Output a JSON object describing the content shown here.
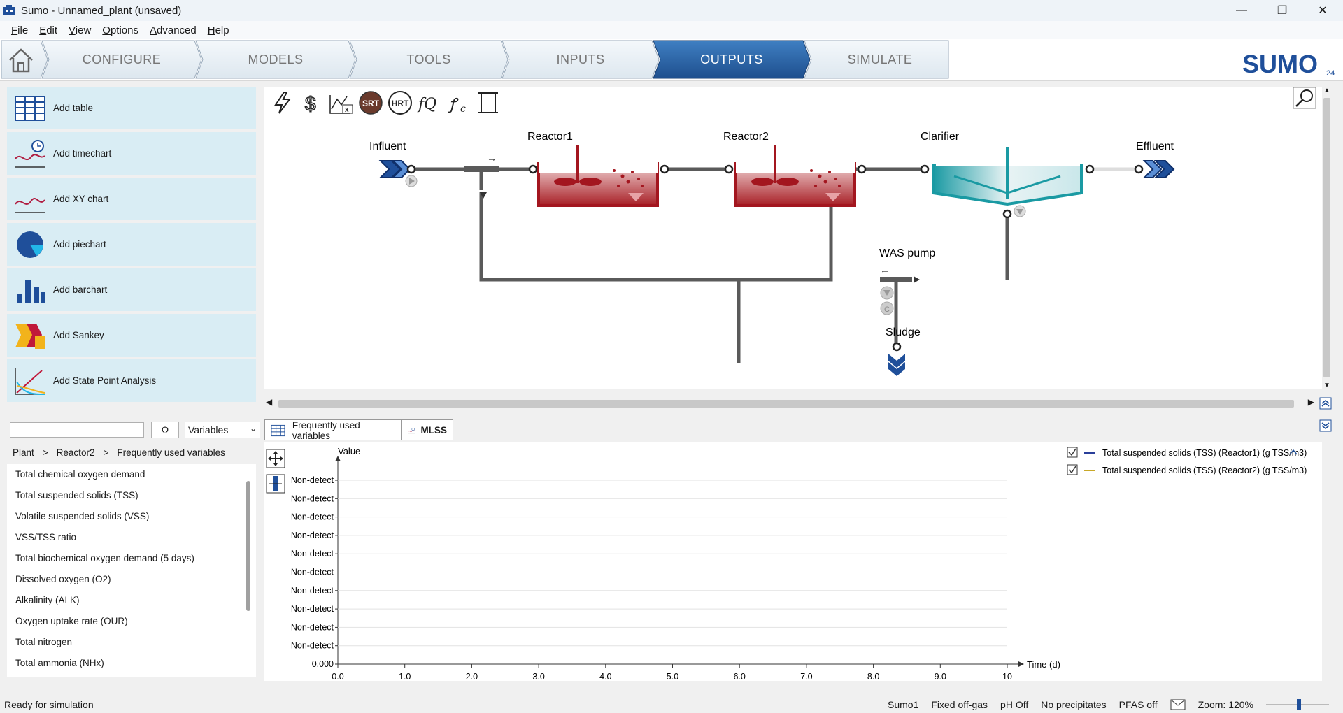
{
  "window": {
    "title": "Sumo - Unnamed_plant (unsaved)"
  },
  "menu": [
    "File",
    "Edit",
    "View",
    "Options",
    "Advanced",
    "Help"
  ],
  "nav": {
    "tabs": [
      "CONFIGURE",
      "MODELS",
      "TOOLS",
      "INPUTS",
      "OUTPUTS",
      "SIMULATE"
    ],
    "active": "OUTPUTS",
    "logo_text": "SUMO",
    "logo_version": "24"
  },
  "left_panel": {
    "buttons": [
      "Add table",
      "Add timechart",
      "Add XY chart",
      "Add piechart",
      "Add barchart",
      "Add Sankey",
      "Add State Point Analysis"
    ]
  },
  "diagram": {
    "toolbar": [
      "lightning-icon",
      "dollar-icon",
      "excel-icon",
      "SRT",
      "HRT",
      "fQ",
      "formula-icon",
      "scroll-icon"
    ],
    "units": {
      "influent": "Influent",
      "reactor1": "Reactor1",
      "reactor2": "Reactor2",
      "clarifier": "Clarifier",
      "effluent": "Effluent",
      "was_pump": "WAS pump",
      "sludge": "Sludge"
    },
    "colors": {
      "reactor": "#a3161f",
      "clarifier": "#1a9aa3",
      "pipe": "#5a5a5a",
      "io": "#1f4f9a"
    }
  },
  "variables": {
    "search_placeholder": "",
    "omega": "Ω",
    "select": "Variables",
    "breadcrumb": [
      "Plant",
      ">",
      "Reactor2",
      ">",
      "Frequently used variables"
    ],
    "items": [
      "Total chemical oxygen demand",
      "Total suspended solids (TSS)",
      "Volatile suspended solids (VSS)",
      "VSS/TSS ratio",
      "Total biochemical oxygen demand (5 days)",
      "Dissolved oxygen (O2)",
      "Alkalinity (ALK)",
      "Oxygen uptake rate (OUR)",
      "Total nitrogen",
      "Total ammonia (NHx)"
    ]
  },
  "output_tabs": [
    {
      "label": "Frequently used variables",
      "icon": "table-icon"
    },
    {
      "label": "MLSS",
      "icon": "timechart-icon"
    }
  ],
  "chart_data": {
    "type": "line",
    "ylabel": "Value",
    "xlabel": "Time (d)",
    "x_ticks": [
      "0.0",
      "1.0",
      "2.0",
      "3.0",
      "4.0",
      "5.0",
      "6.0",
      "7.0",
      "8.0",
      "9.0",
      "10"
    ],
    "y_ticks": [
      "0.000",
      "Non-detect",
      "Non-detect",
      "Non-detect",
      "Non-detect",
      "Non-detect",
      "Non-detect",
      "Non-detect",
      "Non-detect",
      "Non-detect",
      "Non-detect"
    ],
    "xlim": [
      0,
      10
    ],
    "series": [
      {
        "name": "Total suspended solids (TSS) (Reactor1) (g TSS/m3)",
        "color": "#2a3f9a",
        "checked": true,
        "values": []
      },
      {
        "name": "Total suspended solids (TSS) (Reactor2) (g TSS/m3)",
        "color": "#c8a828",
        "checked": true,
        "values": []
      }
    ],
    "grid": true,
    "legend": "top-right"
  },
  "status": {
    "left": "Ready for simulation",
    "items": [
      "Sumo1",
      "Fixed off-gas",
      "pH Off",
      "No precipitates",
      "PFAS off"
    ],
    "zoom": "Zoom: 120%"
  }
}
